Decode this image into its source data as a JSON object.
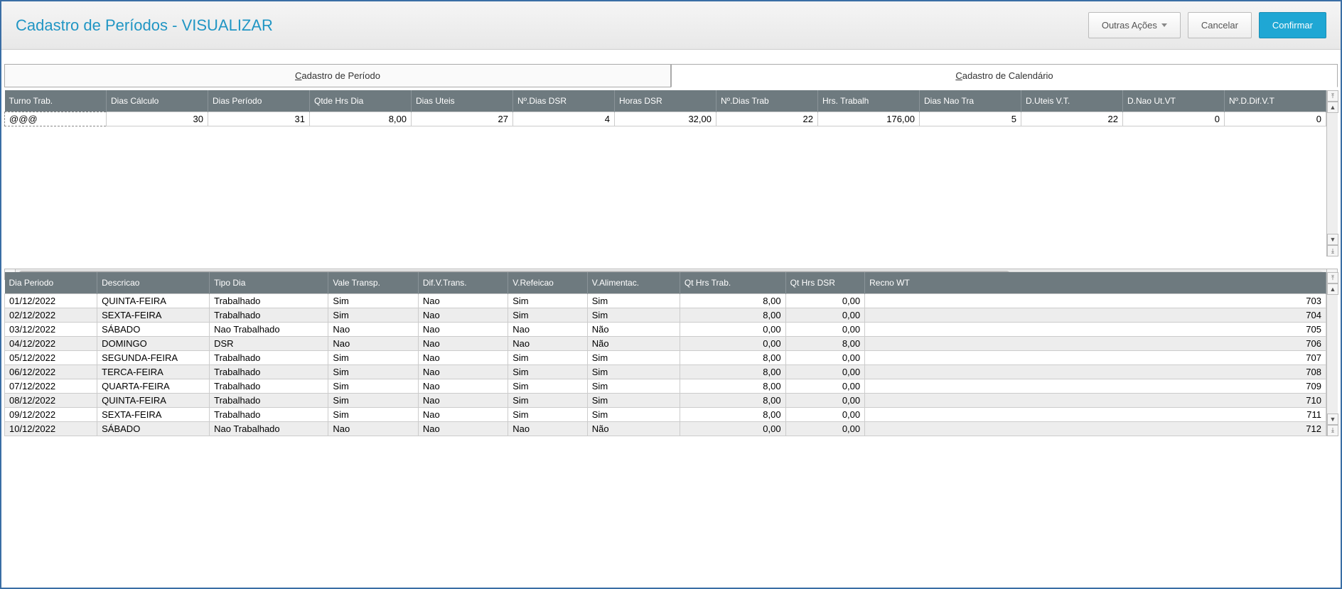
{
  "header": {
    "title": "Cadastro de Períodos - VISUALIZAR",
    "btn_other_actions": "Outras Ações",
    "btn_cancel": "Cancelar",
    "btn_confirm": "Confirmar"
  },
  "tabs": {
    "tab1_prefix": "C",
    "tab1_rest": "adastro de Período",
    "tab2_prefix": "C",
    "tab2_rest": "adastro de Calendário",
    "active_index": 1
  },
  "grid1": {
    "columns": [
      "Turno Trab.",
      "Dias Cálculo",
      "Dias Período",
      "Qtde Hrs Dia",
      "Dias Uteis",
      "Nº.Dias DSR",
      "Horas DSR",
      "Nº.Dias Trab",
      "Hrs. Trabalh",
      "Dias Nao Tra",
      "D.Uteis V.T.",
      "D.Nao Ut.VT",
      "Nº.D.Dif.V.T"
    ],
    "rows": [
      {
        "turno": "@@@",
        "dias_calc": "30",
        "dias_periodo": "31",
        "qtde_hrs_dia": "8,00",
        "dias_uteis": "27",
        "n_dias_dsr": "4",
        "horas_dsr": "32,00",
        "n_dias_trab": "22",
        "hrs_trab": "176,00",
        "dias_nao_tra": "5",
        "d_uteis_vt": "22",
        "d_nao_ut_vt": "0",
        "n_d_dif_vt": "0"
      }
    ]
  },
  "grid2": {
    "columns": [
      "Dia Periodo",
      "Descricao",
      "Tipo Dia",
      "Vale Transp.",
      "Dif.V.Trans.",
      "V.Refeicao",
      "V.Alimentac.",
      "Qt Hrs Trab.",
      "Qt Hrs DSR",
      "Recno WT"
    ],
    "rows": [
      {
        "dia": "01/12/2022",
        "desc": "QUINTA-FEIRA",
        "tipo": "Trabalhado",
        "vt": "Sim",
        "dvt": "Nao",
        "vr": "Sim",
        "va": "Sim",
        "qht": "8,00",
        "qhd": "0,00",
        "recno": "703"
      },
      {
        "dia": "02/12/2022",
        "desc": "SEXTA-FEIRA",
        "tipo": "Trabalhado",
        "vt": "Sim",
        "dvt": "Nao",
        "vr": "Sim",
        "va": "Sim",
        "qht": "8,00",
        "qhd": "0,00",
        "recno": "704"
      },
      {
        "dia": "03/12/2022",
        "desc": "SÁBADO",
        "tipo": "Nao Trabalhado",
        "vt": "Nao",
        "dvt": "Nao",
        "vr": "Nao",
        "va": "Não",
        "qht": "0,00",
        "qhd": "0,00",
        "recno": "705"
      },
      {
        "dia": "04/12/2022",
        "desc": "DOMINGO",
        "tipo": "DSR",
        "vt": "Nao",
        "dvt": "Nao",
        "vr": "Nao",
        "va": "Não",
        "qht": "0,00",
        "qhd": "8,00",
        "recno": "706"
      },
      {
        "dia": "05/12/2022",
        "desc": "SEGUNDA-FEIRA",
        "tipo": "Trabalhado",
        "vt": "Sim",
        "dvt": "Nao",
        "vr": "Sim",
        "va": "Sim",
        "qht": "8,00",
        "qhd": "0,00",
        "recno": "707"
      },
      {
        "dia": "06/12/2022",
        "desc": "TERCA-FEIRA",
        "tipo": "Trabalhado",
        "vt": "Sim",
        "dvt": "Nao",
        "vr": "Sim",
        "va": "Sim",
        "qht": "8,00",
        "qhd": "0,00",
        "recno": "708"
      },
      {
        "dia": "07/12/2022",
        "desc": "QUARTA-FEIRA",
        "tipo": "Trabalhado",
        "vt": "Sim",
        "dvt": "Nao",
        "vr": "Sim",
        "va": "Sim",
        "qht": "8,00",
        "qhd": "0,00",
        "recno": "709"
      },
      {
        "dia": "08/12/2022",
        "desc": "QUINTA-FEIRA",
        "tipo": "Trabalhado",
        "vt": "Sim",
        "dvt": "Nao",
        "vr": "Sim",
        "va": "Sim",
        "qht": "8,00",
        "qhd": "0,00",
        "recno": "710"
      },
      {
        "dia": "09/12/2022",
        "desc": "SEXTA-FEIRA",
        "tipo": "Trabalhado",
        "vt": "Sim",
        "dvt": "Nao",
        "vr": "Sim",
        "va": "Sim",
        "qht": "8,00",
        "qhd": "0,00",
        "recno": "711"
      },
      {
        "dia": "10/12/2022",
        "desc": "SÁBADO",
        "tipo": "Nao Trabalhado",
        "vt": "Nao",
        "dvt": "Nao",
        "vr": "Nao",
        "va": "Não",
        "qht": "0,00",
        "qhd": "0,00",
        "recno": "712"
      }
    ]
  }
}
